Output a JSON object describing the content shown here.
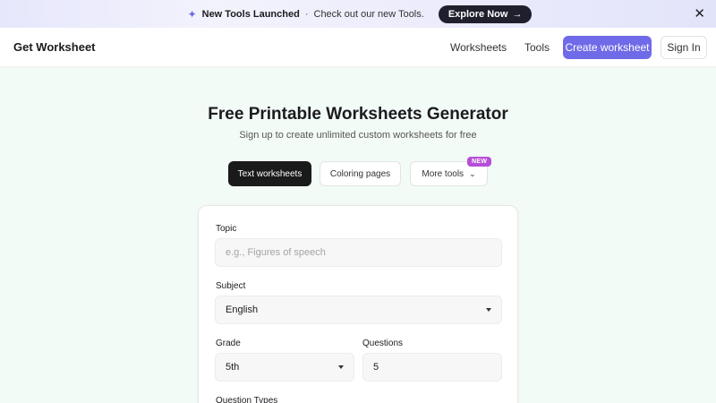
{
  "banner": {
    "title": "New Tools Launched",
    "separator": "·",
    "message": "Check out our new Tools.",
    "cta_label": "Explore Now",
    "cta_arrow": "→",
    "close_glyph": "✕"
  },
  "nav": {
    "brand": "Get Worksheet",
    "links": [
      "Worksheets",
      "Tools"
    ],
    "create_label": "Create worksheet",
    "signin_label": "Sign In"
  },
  "hero": {
    "title": "Free Printable Worksheets Generator",
    "subtitle": "Sign up to create unlimited custom worksheets for free"
  },
  "tabs": {
    "items": [
      "Text worksheets",
      "Coloring pages",
      "More tools"
    ],
    "active": "Text worksheets",
    "badge": "NEW"
  },
  "form": {
    "topic": {
      "label": "Topic",
      "placeholder": "e.g., Figures of speech",
      "value": ""
    },
    "subject": {
      "label": "Subject",
      "value": "English"
    },
    "grade": {
      "label": "Grade",
      "value": "5th"
    },
    "questions": {
      "label": "Questions",
      "value": "5"
    },
    "question_types": {
      "label": "Question Types"
    }
  },
  "colors": {
    "accent": "#6f6be8",
    "badge": "#b54fd6",
    "background": "#f3fbf6",
    "dark_button": "#1a1a1a"
  }
}
